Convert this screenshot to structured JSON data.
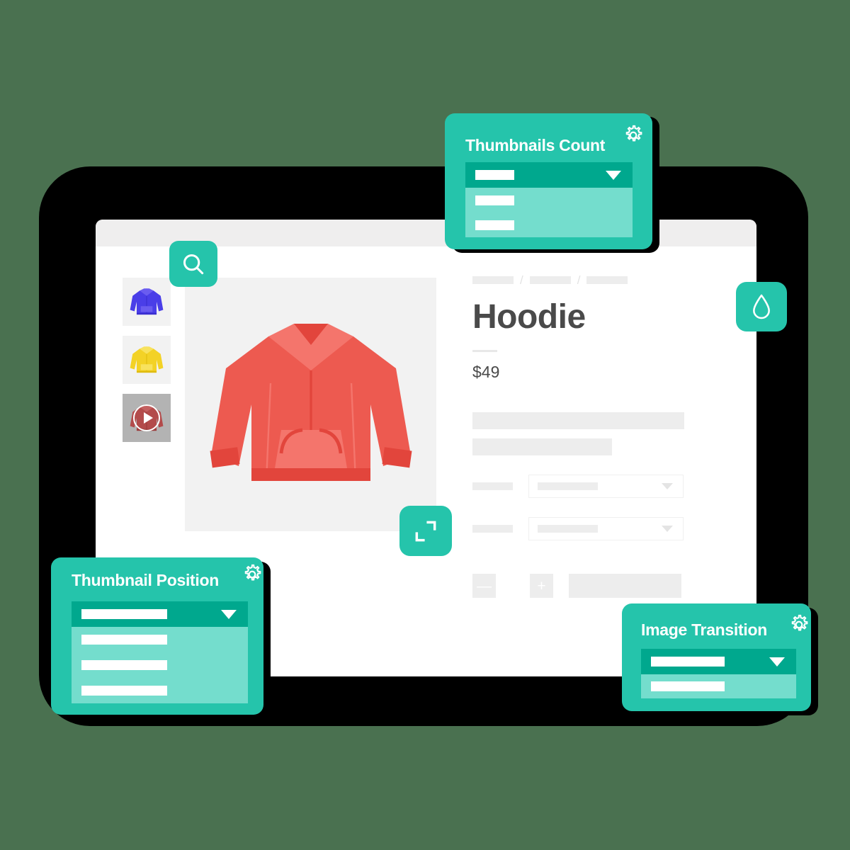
{
  "theme": {
    "background": "#4a7150",
    "accent": "#25c4ab",
    "accent_dark": "#00a88e",
    "accent_light": "#74ddcd",
    "frame": "#000000",
    "screen": "#ffffff",
    "placeholder": "#ededed",
    "hoodie_red": "#ed5a50"
  },
  "browser": {
    "topbar_label": "browser-chrome"
  },
  "gallery": {
    "thumbnails": [
      {
        "name": "thumbnail-hoodie-blue",
        "color": "#4a3ee8",
        "type": "image"
      },
      {
        "name": "thumbnail-hoodie-yellow",
        "color": "#f3d226",
        "type": "image"
      },
      {
        "name": "thumbnail-hoodie-video",
        "color": "#b34b4b",
        "type": "video"
      }
    ],
    "main_image_name": "hoodie-red-main-image"
  },
  "product": {
    "breadcrumb": [
      "",
      "/",
      "",
      "/",
      ""
    ],
    "title": "Hoodie",
    "price": "$49",
    "description_lines": [
      "",
      ""
    ],
    "options": [
      {
        "label": "",
        "value": ""
      },
      {
        "label": "",
        "value": ""
      }
    ],
    "quantity": {
      "decrement_label": "—",
      "increment_label": "+",
      "value": ""
    },
    "add_to_cart_label": ""
  },
  "floating_buttons": [
    {
      "name": "zoom-search-button",
      "icon": "search-icon"
    },
    {
      "name": "color-picker-button",
      "icon": "water-drop-icon"
    },
    {
      "name": "fullscreen-button",
      "icon": "expand-icon"
    }
  ],
  "cards": [
    {
      "id": "card1",
      "title": "Thumbnails Count",
      "gear_icon": "gear-icon",
      "selected_value": "",
      "options": [
        "",
        ""
      ]
    },
    {
      "id": "card2",
      "title": "Thumbnail Position",
      "gear_icon": "gear-icon",
      "selected_value": "",
      "options": [
        "",
        "",
        ""
      ]
    },
    {
      "id": "card3",
      "title": "Image Transition",
      "gear_icon": "gear-icon",
      "selected_value": "",
      "options": [
        ""
      ]
    }
  ]
}
